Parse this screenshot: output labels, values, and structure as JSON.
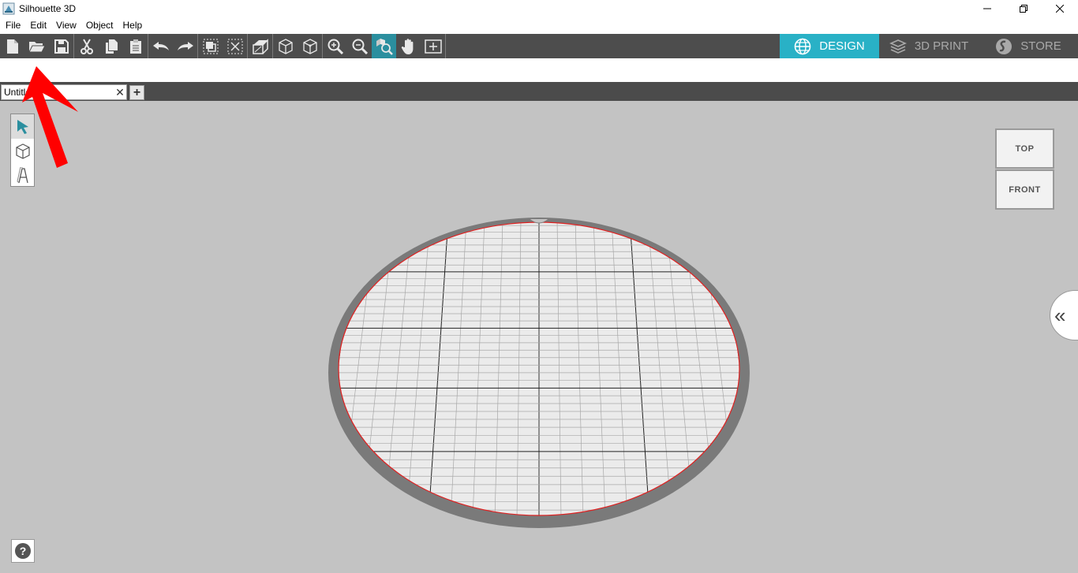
{
  "window": {
    "title": "Silhouette 3D"
  },
  "menu": {
    "items": [
      "File",
      "Edit",
      "View",
      "Object",
      "Help"
    ]
  },
  "toolbar": {
    "tools": [
      {
        "name": "new-file-icon"
      },
      {
        "name": "open-folder-icon"
      },
      {
        "name": "save-icon"
      },
      {
        "name": "cut-icon"
      },
      {
        "name": "copy-icon"
      },
      {
        "name": "paste-icon"
      },
      {
        "name": "undo-icon"
      },
      {
        "name": "redo-icon"
      },
      {
        "name": "group-icon"
      },
      {
        "name": "ungroup-icon"
      },
      {
        "name": "extrude-icon"
      },
      {
        "name": "cube-icon"
      },
      {
        "name": "cube-alt-icon"
      },
      {
        "name": "zoom-in-icon"
      },
      {
        "name": "zoom-out-icon"
      },
      {
        "name": "zoom-fit-icon"
      },
      {
        "name": "pan-hand-icon"
      },
      {
        "name": "fit-page-icon"
      }
    ],
    "active_tool": "zoom-fit-icon"
  },
  "modes": {
    "design": "DESIGN",
    "print": "3D PRINT",
    "store": "STORE",
    "active": "design"
  },
  "document": {
    "tab_name": "Untitled",
    "add_tab": "+"
  },
  "view_cube": {
    "top": "TOP",
    "front": "FRONT"
  },
  "help": {
    "label": "?"
  },
  "colors": {
    "toolbar": "#4d4d4d",
    "accent": "#29b1c6",
    "canvas": "#c3c3c3",
    "bed_edge": "#e02020",
    "annotation": "#ff0000"
  }
}
